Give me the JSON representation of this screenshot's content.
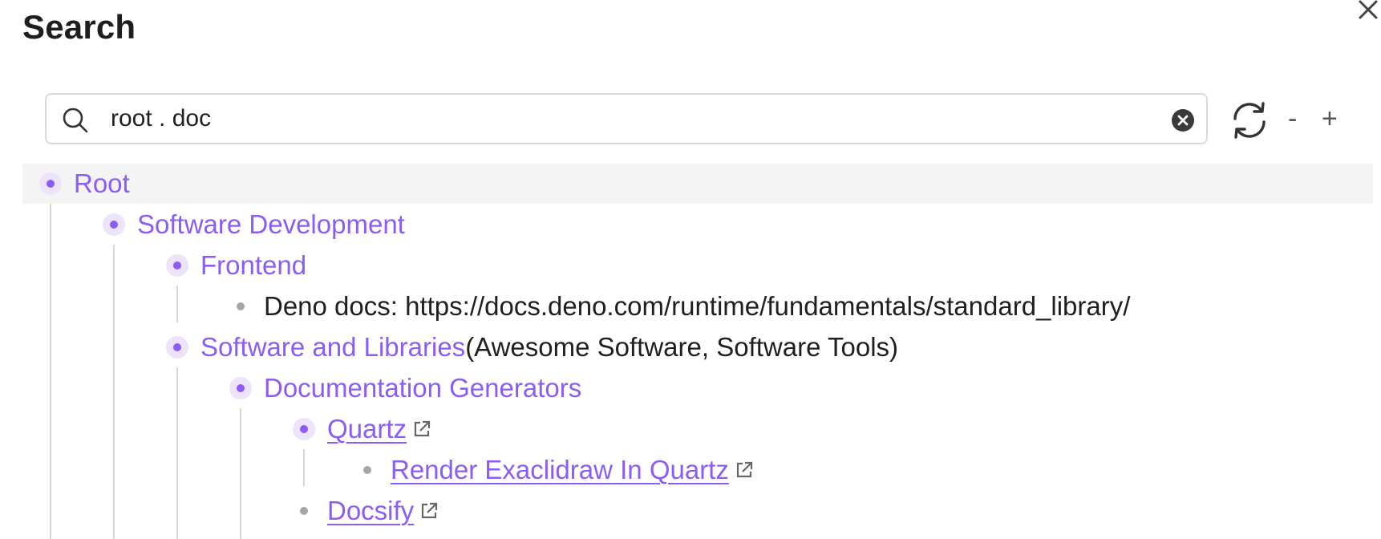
{
  "panel": {
    "title": "Search"
  },
  "search": {
    "value": "root . doc",
    "placeholder": ""
  },
  "controls": {
    "collapse_label": "-",
    "expand_label": "+"
  },
  "colors": {
    "accent": "#8b5cf6",
    "accent_bg": "#ede3fb",
    "leaf_bullet": "#a6a6a6",
    "selected_row": "#f4f4f4"
  },
  "icons": {
    "close": "close-icon",
    "search": "search-icon",
    "clear": "clear-icon",
    "refresh": "refresh-icon",
    "external": "external-link-icon"
  },
  "tree": {
    "root": {
      "label": "Root"
    },
    "software_development": {
      "label": "Software Development"
    },
    "frontend": {
      "label": "Frontend"
    },
    "deno_docs": {
      "label": "Deno docs: https://docs.deno.com/runtime/fundamentals/standard_library/"
    },
    "software_libraries": {
      "label": "Software and Libraries",
      "tags": "(Awesome Software, Software Tools)"
    },
    "doc_generators": {
      "label": "Documentation Generators"
    },
    "quartz": {
      "label": "Quartz"
    },
    "render_excalidraw": {
      "label": "Render Exaclidraw In Quartz"
    },
    "docsify": {
      "label": "Docsify"
    }
  }
}
